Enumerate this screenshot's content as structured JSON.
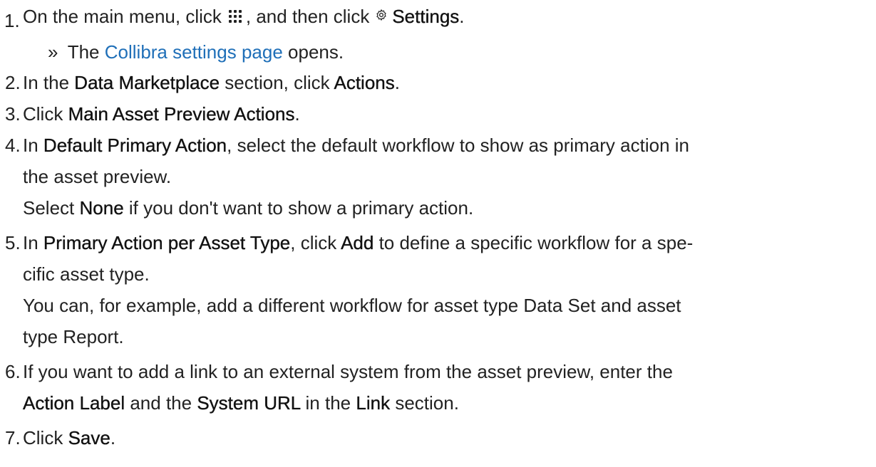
{
  "steps": [
    {
      "number": "1.",
      "parts": {
        "a": "On the main menu, click",
        "b": ", and then click",
        "c": "Settings",
        "d": "."
      },
      "sub": {
        "bullet": "»",
        "prefix": "The",
        "link": "Collibra settings page",
        "suffix": "opens."
      }
    },
    {
      "number": "2.",
      "parts": {
        "a": "In the",
        "b": "Data Marketplace",
        "c": "section, click",
        "d": "Actions",
        "e": "."
      }
    },
    {
      "number": "3.",
      "parts": {
        "a": "Click",
        "b": "Main Asset Preview Actions",
        "c": "."
      }
    },
    {
      "number": "4.",
      "parts": {
        "a": "In",
        "b": "Default Primary Action",
        "c": ", select the default workflow to show as primary action in",
        "d": "the asset preview.",
        "e": "Select",
        "f": "None",
        "g": "if you don't want to show a primary action."
      }
    },
    {
      "number": "5.",
      "parts": {
        "a": "In",
        "b": "Primary Action per Asset Type",
        "c": ", click",
        "d": "Add",
        "e": "to define a specific workflow for a spe-",
        "f": "cific asset type.",
        "g": "You can, for example, add a different workflow for asset type Data Set and asset",
        "h": "type Report."
      }
    },
    {
      "number": "6.",
      "parts": {
        "a": "If you want to add a link to an external system from the asset preview, enter the",
        "b": "Action Label",
        "c": "and the",
        "d": "System URL",
        "e": "in the",
        "f": "Link",
        "g": "section."
      }
    },
    {
      "number": "7.",
      "parts": {
        "a": "Click",
        "b": "Save",
        "c": "."
      }
    }
  ],
  "icons": {
    "menu": "apps-grid-icon",
    "settings": "gear-icon"
  },
  "colors": {
    "text": "#222222",
    "link": "#1f6fb8"
  }
}
